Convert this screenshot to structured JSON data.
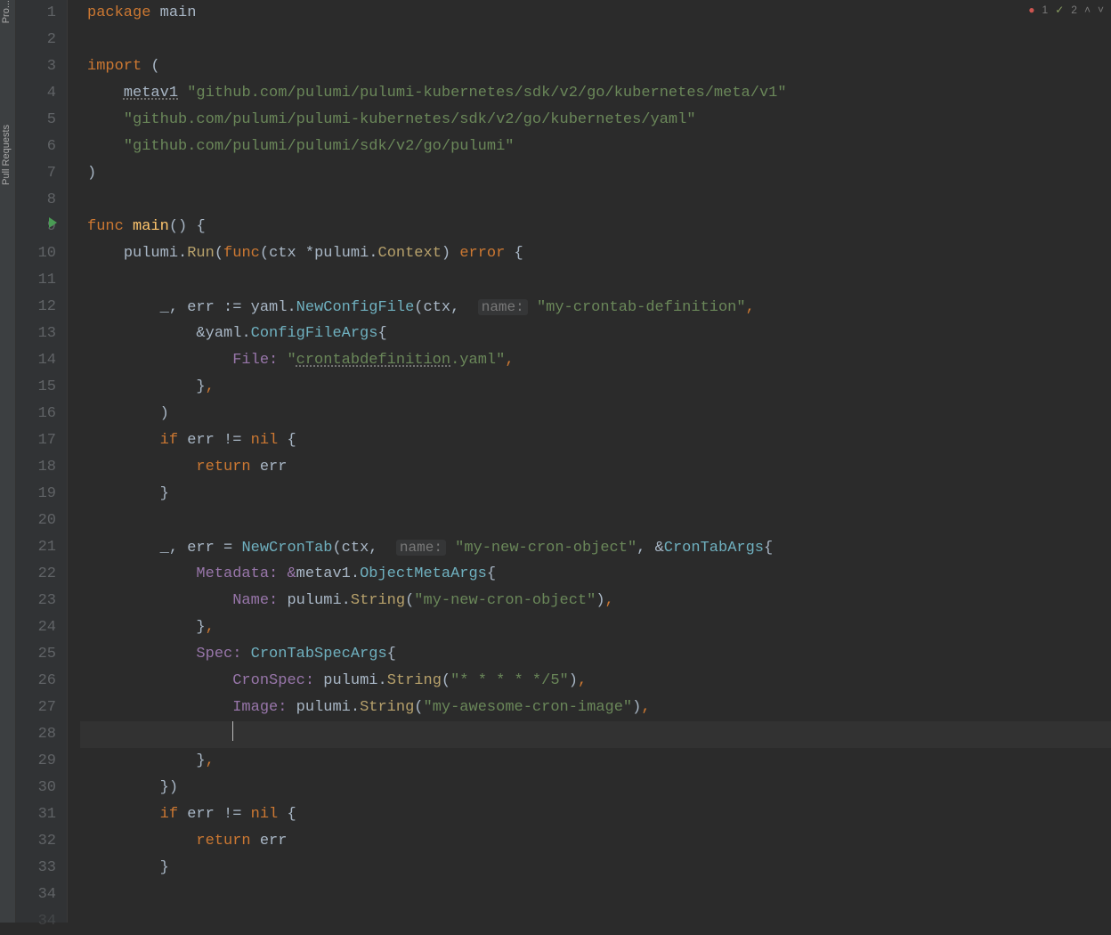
{
  "sidebar": {
    "tab_pull_requests": "Pull Requests",
    "tab_project": "Pro..."
  },
  "inspection": {
    "error_count": "1",
    "warning_count": "2"
  },
  "line_numbers": [
    "1",
    "2",
    "3",
    "4",
    "5",
    "6",
    "7",
    "8",
    "9",
    "10",
    "11",
    "12",
    "13",
    "14",
    "15",
    "16",
    "17",
    "18",
    "19",
    "20",
    "21",
    "22",
    "23",
    "24",
    "25",
    "26",
    "27",
    "28",
    "29",
    "30",
    "31",
    "32",
    "33",
    "34"
  ],
  "code": {
    "l1_package": "package",
    "l1_main": "main",
    "l3_import": "import",
    "l3_paren": "(",
    "l4_metav1": "metav1",
    "l4_path": "\"github.com/pulumi/pulumi-kubernetes/sdk/v2/go/kubernetes/meta/v1\"",
    "l5_path": "\"github.com/pulumi/pulumi-kubernetes/sdk/v2/go/kubernetes/yaml\"",
    "l6_path": "\"github.com/pulumi/pulumi/sdk/v2/go/pulumi\"",
    "l7_paren": ")",
    "l9_func": "func",
    "l9_main": "main",
    "l9_parens": "()",
    "l9_brace": "{",
    "l10_pulumi": "pulumi",
    "l10_run": "Run",
    "l10_func": "func",
    "l10_ctx": "ctx",
    "l10_star_pulumi": "*pulumi",
    "l10_context": "Context",
    "l10_error": "error",
    "l10_brace": "{",
    "l12_blank_err": "_, err := ",
    "l12_yaml": "yaml",
    "l12_newcfg": "NewConfigFile",
    "l12_open": "(ctx, ",
    "l12_hint": "name:",
    "l12_str": "\"my-crontab-definition\"",
    "l12_comma": ",",
    "l13_amp": "&",
    "l13_yaml": "yaml",
    "l13_cfargs": "ConfigFileArgs",
    "l13_brace": "{",
    "l14_file": "File:",
    "l14_str_a": "\"",
    "l14_str_b": "crontabdefinition",
    "l14_str_c": ".yaml\"",
    "l14_comma": ",",
    "l15_close": "},",
    "l16_close": ")",
    "l17_if": "if",
    "l17_err": "err",
    "l17_ne": "!=",
    "l17_nil": "nil",
    "l17_brace": "{",
    "l18_return": "return",
    "l18_err": "err",
    "l19_close": "}",
    "l21_blank_err": "_, err = ",
    "l21_newcrontab": "NewCronTab",
    "l21_open": "(ctx, ",
    "l21_hint": "name:",
    "l21_str": "\"my-new-cron-object\"",
    "l21_amp": ", &",
    "l21_crontabargs": "CronTabArgs",
    "l21_brace": "{",
    "l22_metadata": "Metadata: &",
    "l22_metav1": "metav1",
    "l22_objmeta": "ObjectMetaArgs",
    "l22_brace": "{",
    "l23_name": "Name: ",
    "l23_pulumi": "pulumi",
    "l23_string": "String",
    "l23_open": "(",
    "l23_str": "\"my-new-cron-object\"",
    "l23_close": "),",
    "l24_close": "},",
    "l25_spec": "Spec: ",
    "l25_crontabspec": "CronTabSpecArgs",
    "l25_brace": "{",
    "l26_cronspec": "CronSpec: ",
    "l26_pulumi": "pulumi",
    "l26_string": "String",
    "l26_open": "(",
    "l26_str": "\"* * * * */5\"",
    "l26_close": "),",
    "l27_image": "Image: ",
    "l27_pulumi": "pulumi",
    "l27_string": "String",
    "l27_open": "(",
    "l27_str": "\"my-awesome-cron-image\"",
    "l27_close": "),",
    "l29_close": "},",
    "l30_close": "})",
    "l31_if": "if",
    "l31_err": "err",
    "l31_ne": "!=",
    "l31_nil": "nil",
    "l31_brace": "{",
    "l32_return": "return",
    "l32_err": "err",
    "l33_close": "}"
  }
}
